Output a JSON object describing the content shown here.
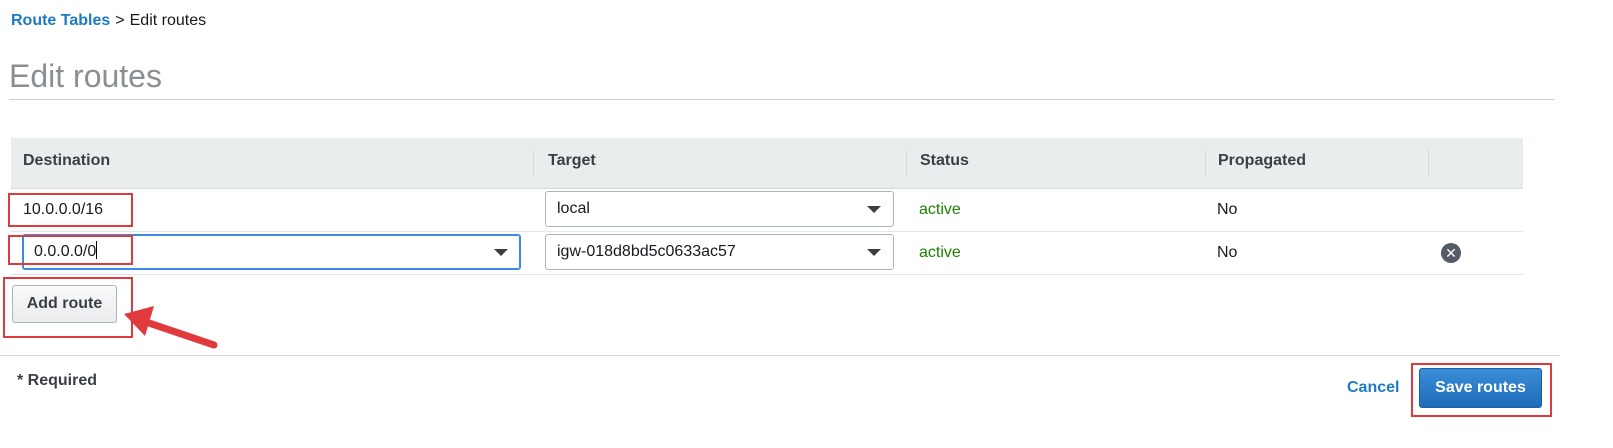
{
  "breadcrumb": {
    "parent": "Route Tables",
    "separator": ">",
    "current": "Edit routes"
  },
  "page_title": "Edit routes",
  "table": {
    "columns": [
      "Destination",
      "Target",
      "Status",
      "Propagated"
    ],
    "rows": [
      {
        "destination": "10.0.0.0/16",
        "target": "local",
        "status": "active",
        "propagated": "No"
      },
      {
        "destination": "0.0.0.0/0",
        "target": "igw-018d8bd5c0633ac57",
        "status": "active",
        "propagated": "No"
      }
    ]
  },
  "buttons": {
    "add_route": "Add route",
    "cancel": "Cancel",
    "save_routes": "Save routes"
  },
  "footer": {
    "required_note": "* Required"
  },
  "colors": {
    "link": "#1f7bc1",
    "status_active": "#1d8102",
    "primary_button": "#1e6bb8",
    "annotation": "#e0393e"
  },
  "icons": {
    "remove_row": "remove-circle-icon",
    "dropdown": "caret-down-icon"
  }
}
